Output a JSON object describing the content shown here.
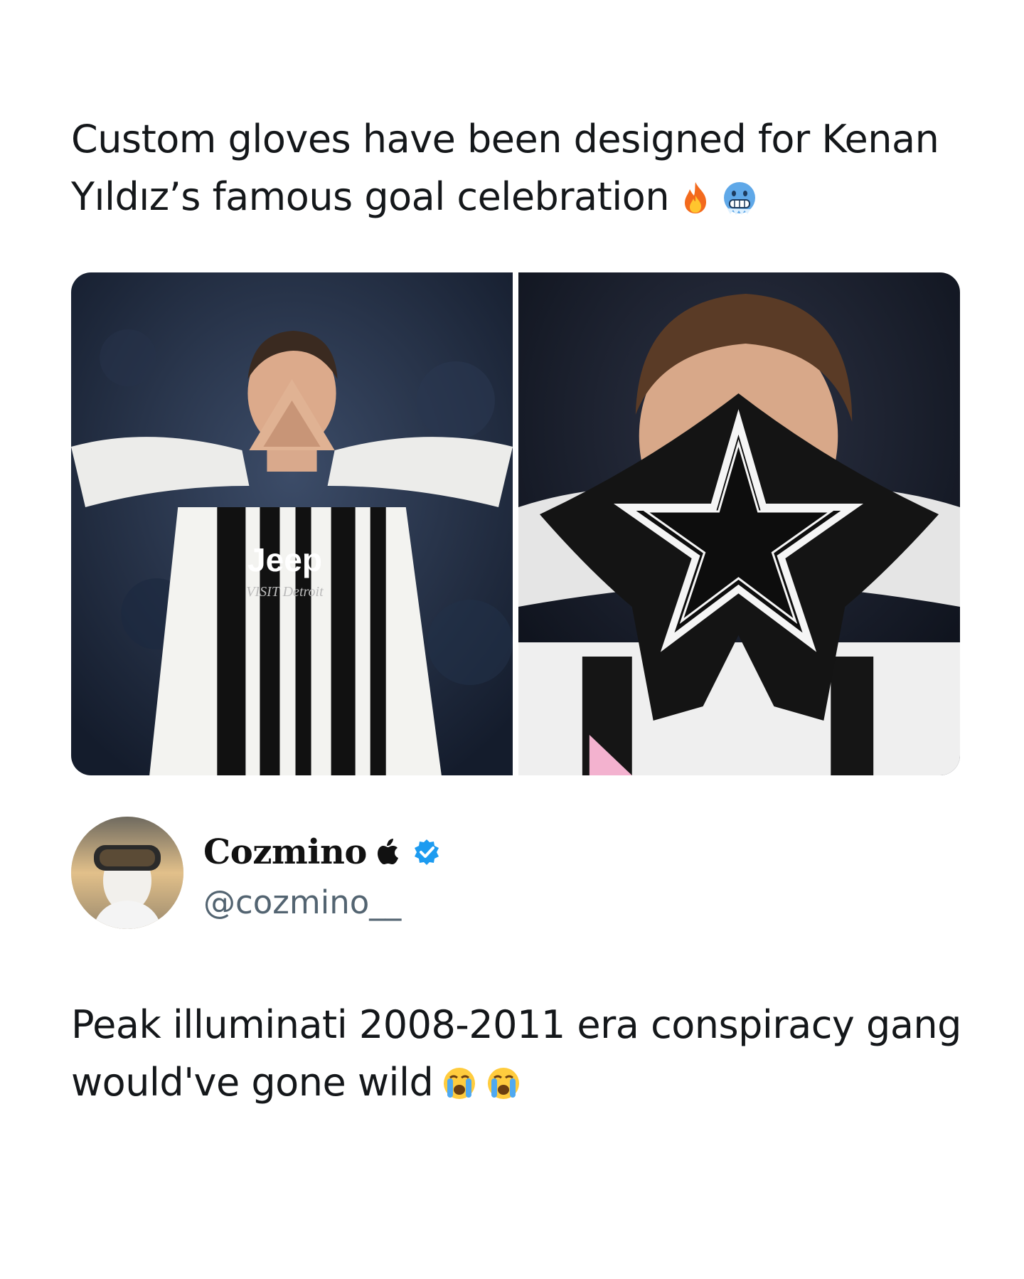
{
  "headline": {
    "text": "Custom gloves have been designed for Kenan Yıldız’s famous goal celebration",
    "emojis": [
      "fire-icon",
      "cold-face-icon"
    ]
  },
  "media": {
    "photos": [
      {
        "jersey_sponsor": "Jeep",
        "jersey_sub": "VISIT Detroit"
      },
      {}
    ]
  },
  "author": {
    "display_name": "Cozmino",
    "handle": "@cozmino__",
    "badges": [
      "apple-icon",
      "verified-icon"
    ],
    "verified_color": "#1d9bf0"
  },
  "reply": {
    "text": "Peak illuminati 2008-2011 era conspiracy gang would've gone wild",
    "emojis": [
      "loudly-crying-face-icon",
      "loudly-crying-face-icon"
    ]
  }
}
